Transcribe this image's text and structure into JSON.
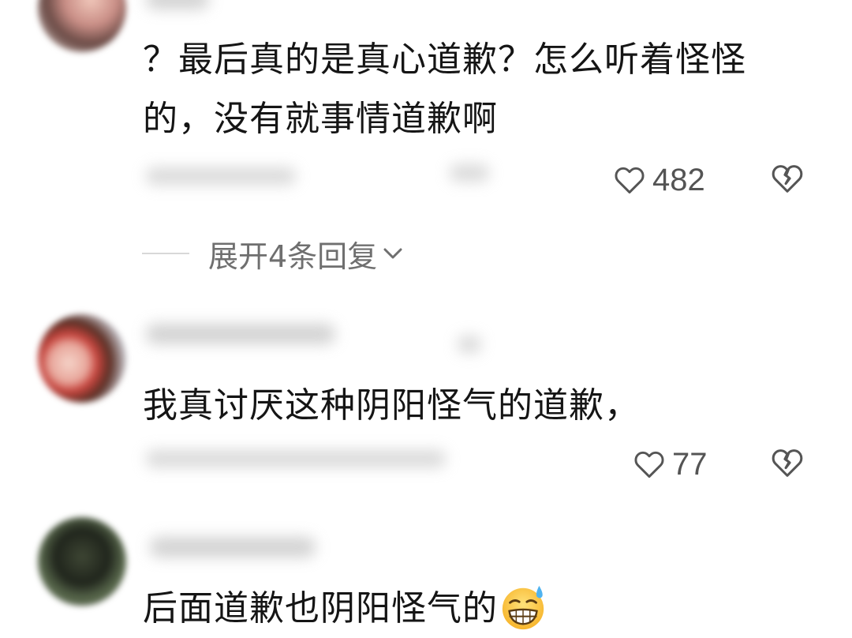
{
  "comments": [
    {
      "text": "？最后真的是真心道歉？怎么听着怪怪的，没有就事情道歉啊",
      "likes": "482"
    },
    {
      "text": "我真讨厌这种阴阳怪气的道歉，",
      "likes": "77"
    },
    {
      "text": "后面道歉也阴阳怪气的",
      "emoji": "grinning-sweat-emoji"
    }
  ],
  "expand_replies": "展开4条回复",
  "icons": {
    "like": "heart-outline-icon",
    "dislike": "broken-heart-icon",
    "expand": "chevron-down-icon"
  },
  "colors": {
    "text": "#151515",
    "count": "#545454",
    "expand": "#6f6f6f"
  }
}
